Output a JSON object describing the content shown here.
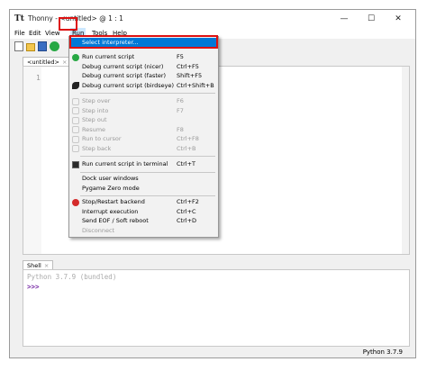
{
  "window": {
    "app_icon": "Tt",
    "title": "Thonny - <untitled> @ 1 : 1",
    "controls": {
      "minimize": "—",
      "maximize": "☐",
      "close": "✕"
    }
  },
  "menubar": [
    "File",
    "Edit",
    "View",
    "Run",
    "Tools",
    "Help"
  ],
  "toolbar": {
    "icons": [
      "new-file-icon",
      "open-file-icon",
      "save-icon",
      "run-icon"
    ]
  },
  "editor": {
    "tab_label": "<untitled>",
    "tab_close": "×",
    "line_numbers": [
      "1"
    ]
  },
  "run_menu": {
    "items": [
      {
        "label": "Select interpreter...",
        "shortcut": "",
        "icon": "",
        "state": "selected"
      },
      {
        "label": "Run current script",
        "shortcut": "F5",
        "icon": "run-icon",
        "state": "enabled"
      },
      {
        "label": "Debug current script (nicer)",
        "shortcut": "Ctrl+F5",
        "icon": "",
        "state": "enabled"
      },
      {
        "label": "Debug current script (faster)",
        "shortcut": "Shift+F5",
        "icon": "",
        "state": "enabled"
      },
      {
        "label": "Debug current script (birdseye)",
        "shortcut": "Ctrl+Shift+B",
        "icon": "birdseye-icon",
        "state": "enabled"
      },
      {
        "label": "Step over",
        "shortcut": "F6",
        "icon": "step-over-icon",
        "state": "disabled"
      },
      {
        "label": "Step into",
        "shortcut": "F7",
        "icon": "step-into-icon",
        "state": "disabled"
      },
      {
        "label": "Step out",
        "shortcut": "",
        "icon": "step-out-icon",
        "state": "disabled"
      },
      {
        "label": "Resume",
        "shortcut": "F8",
        "icon": "resume-icon",
        "state": "disabled"
      },
      {
        "label": "Run to cursor",
        "shortcut": "Ctrl+F8",
        "icon": "run-to-cursor-icon",
        "state": "disabled"
      },
      {
        "label": "Step back",
        "shortcut": "Ctrl+B",
        "icon": "step-back-icon",
        "state": "disabled"
      },
      {
        "label": "Run current script in terminal",
        "shortcut": "Ctrl+T",
        "icon": "terminal-icon",
        "state": "enabled"
      },
      {
        "label": "Dock user windows",
        "shortcut": "",
        "icon": "",
        "state": "enabled"
      },
      {
        "label": "Pygame Zero mode",
        "shortcut": "",
        "icon": "",
        "state": "enabled"
      },
      {
        "label": "Stop/Restart backend",
        "shortcut": "Ctrl+F2",
        "icon": "stop-icon",
        "state": "enabled"
      },
      {
        "label": "Interrupt execution",
        "shortcut": "Ctrl+C",
        "icon": "",
        "state": "enabled"
      },
      {
        "label": "Send EOF / Soft reboot",
        "shortcut": "Ctrl+D",
        "icon": "",
        "state": "enabled"
      },
      {
        "label": "Disconnect",
        "shortcut": "",
        "icon": "",
        "state": "disabled"
      }
    ]
  },
  "shell": {
    "tab_label": "Shell",
    "tab_close": "×",
    "banner": "Python 3.7.9 (bundled)",
    "prompt": ">>>"
  },
  "statusbar": {
    "interpreter": "Python 3.7.9"
  },
  "colors": {
    "highlight": "#0078d7",
    "annotation_outline": "#dd1111",
    "prompt": "#7c31a8",
    "run_green": "#27a844",
    "stop_red": "#d42b2b"
  }
}
